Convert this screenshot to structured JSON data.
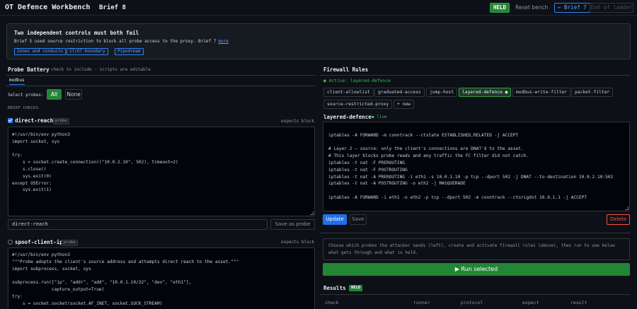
{
  "header": {
    "app_title": "OT Defence Workbench",
    "brief_label": "Brief 8",
    "status_badge": "HELD",
    "reset_label": "Reset bench",
    "prev_label": "← Brief 7",
    "end_label": "End of ladder"
  },
  "brief": {
    "heading": "Two independent controls must both fail",
    "text": "Brief 5 used source restriction to block all probe access to the proxy. Brief 7",
    "more_label": "more",
    "chips": [
      "Zones and conduits",
      "IT/OT boundary",
      "Pipedream"
    ]
  },
  "probe_battery": {
    "title": "Probe Battery",
    "subtitle": "check to include · scripts are editable",
    "tab_label": "modbus",
    "select_label": "Select probes:",
    "all_label": "All",
    "none_label": "None",
    "section_label": "BRIEF CHECKS",
    "probes": [
      {
        "name": "direct-reach",
        "tag": "probe",
        "expects": "expects block",
        "checked": true,
        "code": [
          "#!/usr/bin/env python3",
          "import socket, sys",
          "",
          "try:",
          "    s = socket.create_connection((\"10.0.2.10\", 502), timeout=2)",
          "    s.close()",
          "    sys.exit(0)",
          "except OSError:",
          "    sys.exit(1)"
        ]
      },
      {
        "name": "spoof-client-ip",
        "tag": "probe",
        "expects": "expects block",
        "checked": false,
        "code": [
          "#!/usr/bin/env python3",
          "\"\"\"Probe adopts the client's source address and attempts direct reach to the asset.\"\"\"",
          "import subprocess, socket, sys",
          "",
          "subprocess.run([\"ip\", \"addr\", \"add\", \"10.0.1.10/32\", \"dev\", \"eth1\"],",
          "               capture_output=True)",
          "try:",
          "    s = socket.socket(socket.AF_INET, socket.SOCK_STREAM)"
        ]
      }
    ],
    "name_input_value": "direct-reach",
    "save_probe_label": "Save as probe"
  },
  "firewall": {
    "title": "Firewall Rules",
    "active_text": "● Active: layered-defence",
    "rules": [
      "client-allowlist",
      "graduated-access",
      "jump-host",
      "layered-defence ●",
      "modbus-write-filter",
      "packet-filter",
      "source-restricted-proxy",
      "+ new"
    ],
    "selected_rule": "layered-defence",
    "live_label": "● live",
    "code": [
      "",
      "iptables -A FORWARD -m conntrack --ctstate ESTABLISHED,RELATED -j ACCEPT",
      "",
      "# Layer 2 — source: only the client's connections are DNAT'd to the asset.",
      "# This layer blocks probe reads and any traffic the FC filter did not catch.",
      "iptables -t nat -F PREROUTING",
      "iptables -t nat -F POSTROUTING",
      "iptables -t nat -A PREROUTING -i eth1 -s 10.0.1.10 -p tcp --dport 502 -j DNAT --to-destination 10.0.2.10:502",
      "iptables -t nat -A POSTROUTING -o eth2 -j MASQUERADE",
      "",
      "iptables -A FORWARD -i eth1 -o eth2 -p tcp --dport 502 -m conntrack --ctorigdst 10.0.1.1 -j ACCEPT"
    ],
    "update_label": "Update",
    "save_label": "Save",
    "delete_label": "Delete"
  },
  "run": {
    "instructions": "Choose which probes the attacker sends (left), create and activate firewall rules (above), then run to see below what gets through and what is held.",
    "run_label": "▶ Run selected"
  },
  "results": {
    "title": "Results",
    "badge": "HELD",
    "columns": [
      "check",
      "runner",
      "protocol",
      "expect",
      "result"
    ]
  }
}
